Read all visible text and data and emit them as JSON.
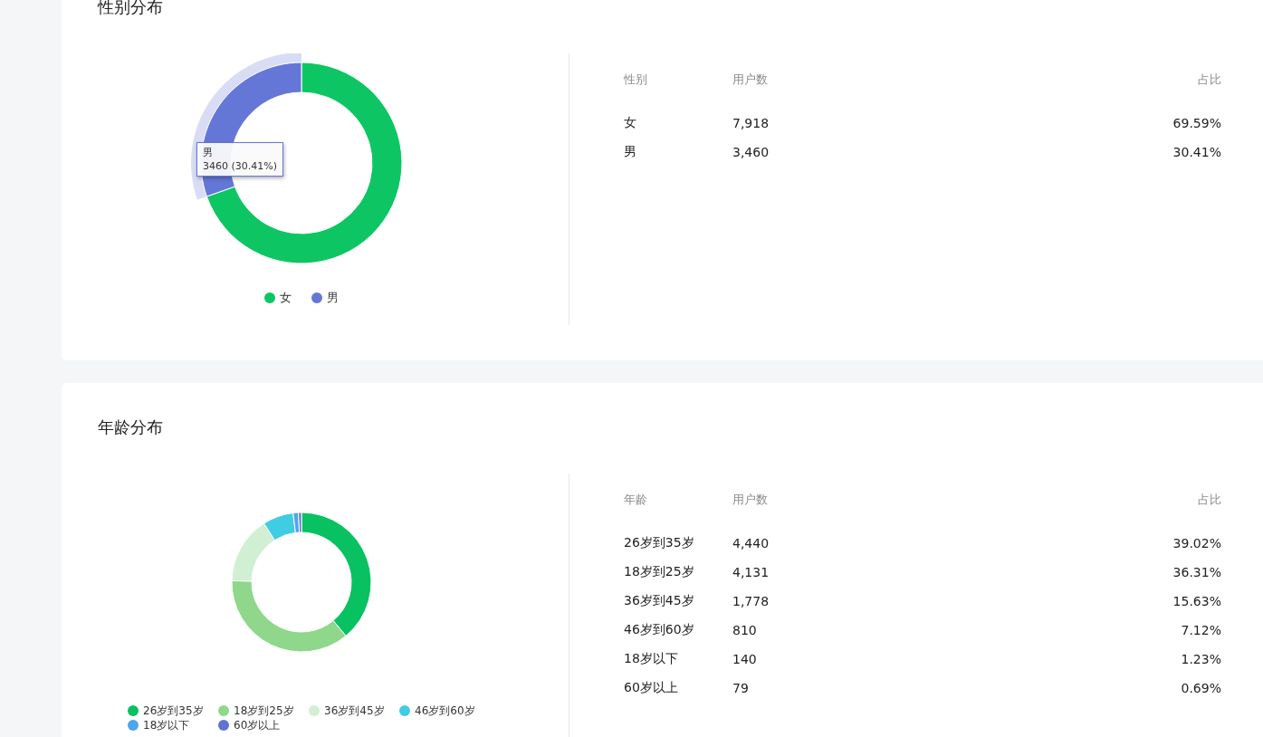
{
  "sections": [
    {
      "title": "性别分布",
      "chart": {
        "kind": "large",
        "chart_data": {
          "type": "donut",
          "categories": [
            "女",
            "男"
          ],
          "values": [
            69.59,
            30.41
          ]
        },
        "tooltip": {
          "title": "男",
          "text": "3460 (30.41%)"
        }
      },
      "legend": {
        "kind": "row",
        "items": [
          {
            "color": "#0dc663",
            "highlighted": false
          },
          {
            "color": "#6577d6",
            "highlighted": true
          }
        ]
      },
      "table": {
        "columns": [
          "性别",
          "用户数",
          "占比"
        ],
        "rows": [
          [
            "女",
            "7,918",
            "69.59%"
          ],
          [
            "男",
            "3,460",
            "30.41%"
          ]
        ]
      }
    },
    {
      "title": "年龄分布",
      "chart": {
        "kind": "small",
        "chart_data": {
          "type": "donut",
          "categories": [
            "26岁到35岁",
            "18岁到25岁",
            "36岁到45岁",
            "46岁到60岁",
            "18岁以下",
            "60岁以上"
          ],
          "values": [
            39.02,
            36.31,
            15.63,
            7.12,
            1.23,
            0.69
          ]
        }
      },
      "legend": {
        "kind": "grid",
        "items": [
          {
            "color": "#08c161",
            "highlighted": false
          },
          {
            "color": "#8ed78b",
            "highlighted": false
          },
          {
            "color": "#d1efd3",
            "highlighted": false
          },
          {
            "color": "#40cce2",
            "highlighted": false
          },
          {
            "color": "#4ea5ea",
            "highlighted": false
          },
          {
            "color": "#5f73d3",
            "highlighted": false
          }
        ]
      },
      "table": {
        "columns": [
          "年龄",
          "用户数",
          "占比"
        ],
        "rows": [
          [
            "26岁到35岁",
            "4,440",
            "39.02%"
          ],
          [
            "18岁到25岁",
            "4,131",
            "36.31%"
          ],
          [
            "36岁到45岁",
            "1,778",
            "15.63%"
          ],
          [
            "46岁到60岁",
            "810",
            "7.12%"
          ],
          [
            "18岁以下",
            "140",
            "1.23%"
          ],
          [
            "60岁以上",
            "79",
            "0.69%"
          ]
        ]
      }
    }
  ]
}
